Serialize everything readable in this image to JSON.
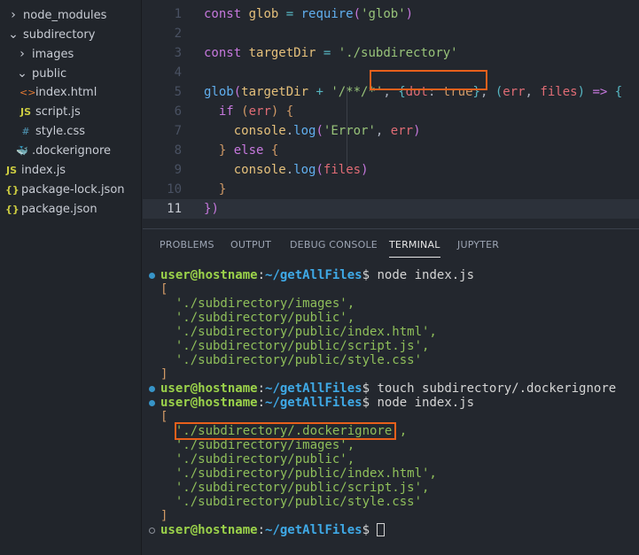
{
  "explorer": {
    "items": [
      {
        "label": "node_modules",
        "icon": "chevron-right-icon",
        "glyph": "›",
        "depth": 0
      },
      {
        "label": "subdirectory",
        "icon": "chevron-down-icon",
        "glyph": "⌄",
        "depth": 0
      },
      {
        "label": "images",
        "icon": "chevron-right-icon",
        "glyph": "›",
        "depth": 1
      },
      {
        "label": "public",
        "icon": "chevron-down-icon",
        "glyph": "⌄",
        "depth": 1
      },
      {
        "label": "index.html",
        "icon": "html-file-icon",
        "glyph": "<>",
        "depth": 2,
        "color": "#e37933"
      },
      {
        "label": "script.js",
        "icon": "js-file-icon",
        "glyph": "JS",
        "depth": 2,
        "color": "#cbcb41"
      },
      {
        "label": "style.css",
        "icon": "css-file-icon",
        "glyph": "#",
        "depth": 2,
        "color": "#519aba"
      },
      {
        "label": ".dockerignore",
        "icon": "docker-file-icon",
        "glyph": "🐳",
        "depth": 1,
        "color": "#6b7280"
      },
      {
        "label": "index.js",
        "icon": "js-file-icon",
        "glyph": "JS",
        "depth": -1,
        "color": "#cbcb41"
      },
      {
        "label": "package-lock.json",
        "icon": "json-file-icon",
        "glyph": "{}",
        "depth": -1,
        "color": "#cbcb41"
      },
      {
        "label": "package.json",
        "icon": "json-file-icon",
        "glyph": "{}",
        "depth": -1,
        "color": "#cbcb41"
      }
    ]
  },
  "editor": {
    "current_line": 11,
    "lines": [
      [
        [
          "const",
          "kw"
        ],
        [
          " glob ",
          "var"
        ],
        [
          "=",
          "op"
        ],
        [
          " ",
          "pu"
        ],
        [
          "require",
          "fn"
        ],
        [
          "(",
          "p1"
        ],
        [
          "'glob'",
          "str"
        ],
        [
          ")",
          "p1"
        ]
      ],
      [],
      [
        [
          "const",
          "kw"
        ],
        [
          " targetDir ",
          "var"
        ],
        [
          "=",
          "op"
        ],
        [
          " ",
          "pu"
        ],
        [
          "'./subdirectory'",
          "str"
        ]
      ],
      [],
      [
        [
          "glob",
          "fn"
        ],
        [
          "(",
          "p1"
        ],
        [
          "targetDir ",
          "var"
        ],
        [
          "+",
          "op"
        ],
        [
          " ",
          "pu"
        ],
        [
          "'/**/*'",
          "str"
        ],
        [
          ", ",
          "pu"
        ],
        [
          "{",
          "p2"
        ],
        [
          "dot",
          "prm"
        ],
        [
          ": ",
          "pu"
        ],
        [
          "true",
          "p3"
        ],
        [
          "}",
          "p2"
        ],
        [
          ", ",
          "pu"
        ],
        [
          "(",
          "p2"
        ],
        [
          "err",
          "prm"
        ],
        [
          ", ",
          "pu"
        ],
        [
          "files",
          "prm"
        ],
        [
          ")",
          "p2"
        ],
        [
          " ",
          "pu"
        ],
        [
          "=>",
          "kw"
        ],
        [
          " ",
          "pu"
        ],
        [
          "{",
          "p2"
        ]
      ],
      [
        [
          "  ",
          "pu"
        ],
        [
          "if",
          "kw"
        ],
        [
          " ",
          "pu"
        ],
        [
          "(",
          "p3"
        ],
        [
          "err",
          "prm"
        ],
        [
          ")",
          "p3"
        ],
        [
          " ",
          "pu"
        ],
        [
          "{",
          "p3"
        ]
      ],
      [
        [
          "    ",
          "pu"
        ],
        [
          "console",
          "var"
        ],
        [
          ".",
          "pu"
        ],
        [
          "log",
          "fn"
        ],
        [
          "(",
          "p1"
        ],
        [
          "'Error'",
          "str"
        ],
        [
          ", ",
          "pu"
        ],
        [
          "err",
          "prm"
        ],
        [
          ")",
          "p1"
        ]
      ],
      [
        [
          "  ",
          "pu"
        ],
        [
          "}",
          "p3"
        ],
        [
          " ",
          "pu"
        ],
        [
          "else",
          "kw"
        ],
        [
          " ",
          "pu"
        ],
        [
          "{",
          "p3"
        ]
      ],
      [
        [
          "    ",
          "pu"
        ],
        [
          "console",
          "var"
        ],
        [
          ".",
          "pu"
        ],
        [
          "log",
          "fn"
        ],
        [
          "(",
          "p1"
        ],
        [
          "files",
          "prm"
        ],
        [
          ")",
          "p1"
        ]
      ],
      [
        [
          "  ",
          "pu"
        ],
        [
          "}",
          "p3"
        ]
      ],
      [
        [
          "}",
          "p1"
        ],
        [
          ")",
          "p1"
        ]
      ]
    ]
  },
  "panel": {
    "tabs": [
      "PROBLEMS",
      "OUTPUT",
      "DEBUG CONSOLE",
      "TERMINAL",
      "JUPYTER"
    ],
    "active_tab": "TERMINAL",
    "prompt": {
      "user": "user@hostname",
      "sep": ":",
      "path": "~/getAllFiles",
      "sign": "$"
    },
    "terminal": [
      {
        "type": "cmd",
        "text": " node index.js"
      },
      {
        "type": "br",
        "text": "["
      },
      {
        "type": "str",
        "text": "  './subdirectory/images',"
      },
      {
        "type": "str",
        "text": "  './subdirectory/public',"
      },
      {
        "type": "str",
        "text": "  './subdirectory/public/index.html',"
      },
      {
        "type": "str",
        "text": "  './subdirectory/public/script.js',"
      },
      {
        "type": "str",
        "text": "  './subdirectory/public/style.css'"
      },
      {
        "type": "br",
        "text": "]"
      },
      {
        "type": "cmd",
        "text": " touch subdirectory/.dockerignore"
      },
      {
        "type": "cmd",
        "text": " node index.js"
      },
      {
        "type": "br",
        "text": "["
      },
      {
        "type": "str",
        "text": "  './subdirectory/.dockerignore',"
      },
      {
        "type": "str",
        "text": "  './subdirectory/images',"
      },
      {
        "type": "str",
        "text": "  './subdirectory/public',"
      },
      {
        "type": "str",
        "text": "  './subdirectory/public/index.html',"
      },
      {
        "type": "str",
        "text": "  './subdirectory/public/script.js',"
      },
      {
        "type": "str",
        "text": "  './subdirectory/public/style.css'"
      },
      {
        "type": "br",
        "text": "]"
      },
      {
        "type": "prompt",
        "text": " "
      }
    ]
  },
  "colors": {
    "highlight": "#e8601c"
  }
}
